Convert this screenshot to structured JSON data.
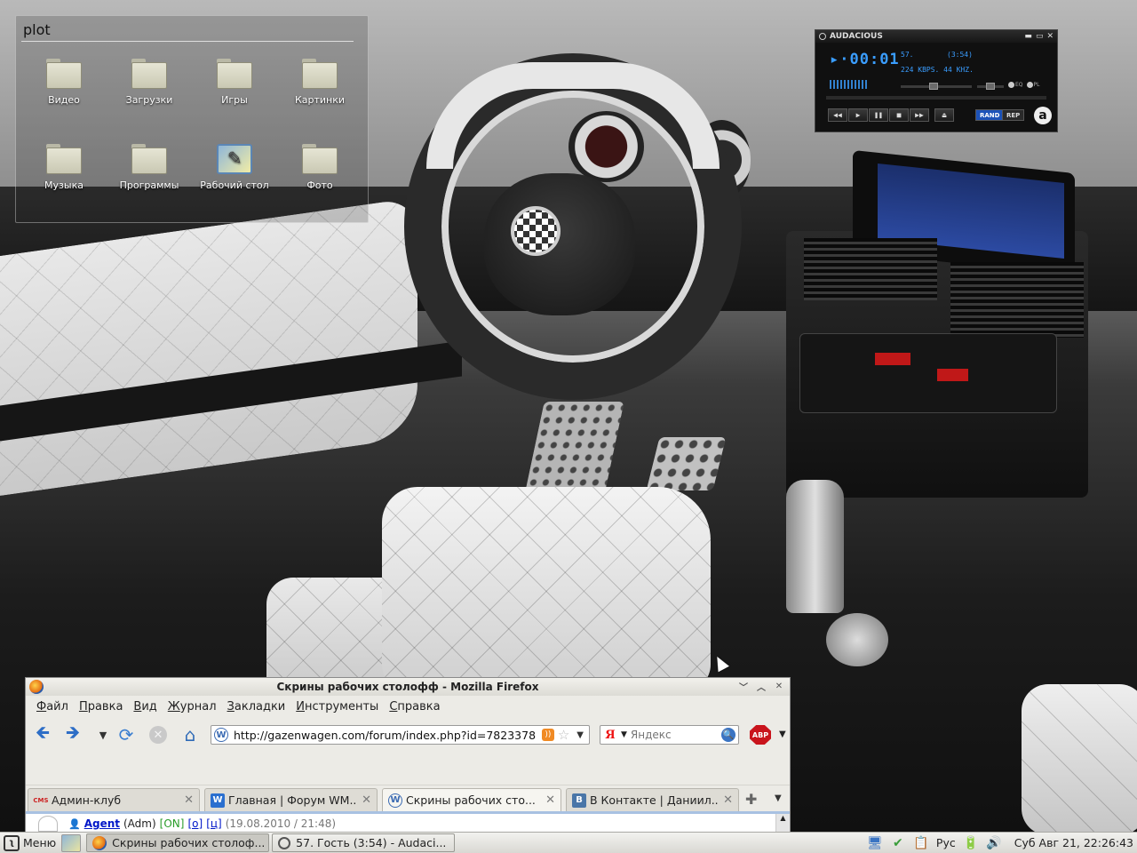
{
  "desktop": {
    "folder_widget": {
      "title": "plot",
      "items": [
        {
          "label": "Видео",
          "icon": "folder-icon"
        },
        {
          "label": "Загрузки",
          "icon": "folder-icon"
        },
        {
          "label": "Игры",
          "icon": "folder-icon"
        },
        {
          "label": "Картинки",
          "icon": "folder-icon"
        },
        {
          "label": "Музыка",
          "icon": "folder-icon"
        },
        {
          "label": "Программы",
          "icon": "folder-icon"
        },
        {
          "label": "Рабочий стол",
          "icon": "desktop-icon"
        },
        {
          "label": "Фото",
          "icon": "folder-icon"
        }
      ]
    }
  },
  "audacious": {
    "title": "AUDACIOUS",
    "time": "00:01",
    "track_number": "57.",
    "track_length": "(3:54)",
    "info": "224 KBPS. 44 KHZ.",
    "eq_label": "EQ",
    "pl_label": "PL",
    "controls": [
      "◀◀",
      "▶",
      "❚❚",
      "■",
      "▶▶"
    ],
    "eject": "⏏",
    "rand": "RAND",
    "rep": "REP",
    "logo": "a",
    "accent": "#3a9dff"
  },
  "firefox": {
    "window_title": "Скрины рабочих столофф - Mozilla Firefox",
    "menu": [
      {
        "u": "Ф",
        "rest": "айл"
      },
      {
        "u": "П",
        "rest": "равка"
      },
      {
        "u": "В",
        "rest": "ид"
      },
      {
        "u": "Ж",
        "rest": "урнал"
      },
      {
        "u": "З",
        "rest": "акладки"
      },
      {
        "u": "И",
        "rest": "нструменты"
      },
      {
        "u": "С",
        "rest": "правка"
      }
    ],
    "url": "http://gazenwagen.com/forum/index.php?id=7823378",
    "search_placeholder": "Яндекс",
    "search_engine_glyph": "Я",
    "abp_label": "ABP",
    "tabs": [
      {
        "label": "Админ-клуб",
        "icon": "cms-icon",
        "icon_bg": "#ffffff",
        "active": false
      },
      {
        "label": "Главная | Форум WM...",
        "icon": "w-icon",
        "icon_bg": "#2a6fcf",
        "active": false
      },
      {
        "label": "Скрины рабочих сто...",
        "icon": "site-icon",
        "icon_bg": "#ffffff",
        "active": true
      },
      {
        "label": "В Контакте | Даниил...",
        "icon": "vk-icon",
        "icon_bg": "#4a76a8",
        "active": false
      }
    ],
    "post": {
      "author": "Agent",
      "role": "(Adm)",
      "status": "[ON]",
      "link1": "[о]",
      "link2": "[ц]",
      "date": "(19.08.2010 / 21:48)"
    }
  },
  "taskbar": {
    "menu_label": "Меню",
    "tasks": [
      {
        "label": "Скрины рабочих столоф...",
        "icon": "firefox-icon",
        "active": true
      },
      {
        "label": "57. Гость (3:54) - Audaci...",
        "icon": "audacious-icon",
        "active": false
      }
    ],
    "lang": "Рус",
    "clock": "Суб Авг 21, 22:26:43"
  }
}
